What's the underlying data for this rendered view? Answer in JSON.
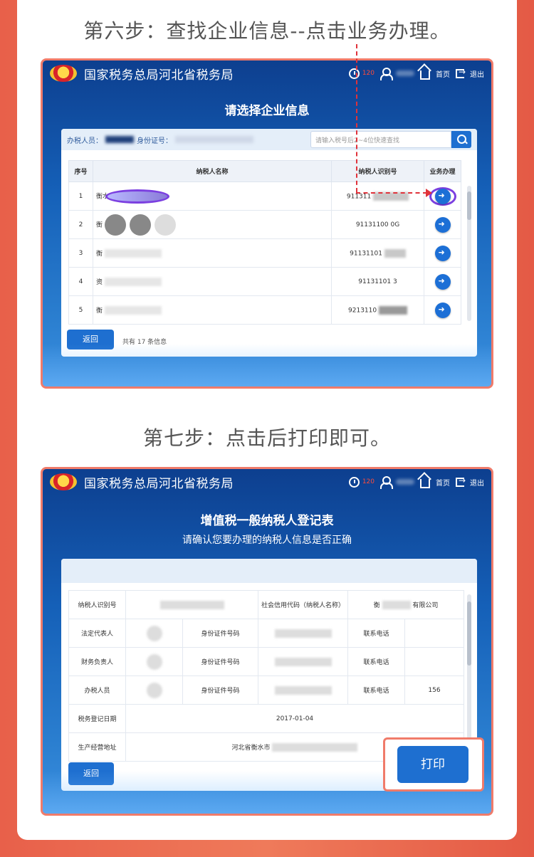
{
  "step6": {
    "title": "第六步：查找企业信息--点击业务办理。",
    "app_title": "国家税务总局河北省税务局",
    "timer": "120",
    "home_label": "首页",
    "logout_label": "退出",
    "panel_title": "请选择企业信息",
    "taxpayer_label": "办税人员：",
    "id_label": "身份证号：",
    "search_placeholder": "请输入税号后2~4位快速查找",
    "columns": [
      "序号",
      "纳税人名称",
      "纳税人识别号",
      "业务办理"
    ],
    "rows": [
      {
        "no": "1",
        "name": "衡水",
        "tax_id": "911311"
      },
      {
        "no": "2",
        "name": "衡",
        "tax_id": "91131100 0G"
      },
      {
        "no": "3",
        "name": "衡",
        "tax_id": "91131101"
      },
      {
        "no": "4",
        "name": "资",
        "tax_id": "91131101 3"
      },
      {
        "no": "5",
        "name": "衡",
        "tax_id": "9213110"
      }
    ],
    "back_label": "返回",
    "total_text": "共有 17 条信息"
  },
  "step7": {
    "title": "第七步：点击后打印即可。",
    "app_title": "国家税务总局河北省税务局",
    "timer": "120",
    "home_label": "首页",
    "logout_label": "退出",
    "panel_title": "增值税一般纳税人登记表",
    "panel_sub": "请确认您要办理的纳税人信息是否正确",
    "fields": {
      "taxpayer_id": "纳税人识别号",
      "credit_code": "社会信用代码（纳税人名称）",
      "company": "衡",
      "company_suffix": "有限公司",
      "legal_rep": "法定代表人",
      "id_type": "身份证件号码",
      "phone": "联系电话",
      "finance": "财务负责人",
      "agent": "办税人员",
      "phone_value": "156",
      "reg_date_label": "税务登记日期",
      "reg_date": "2017-01-04",
      "address_label": "生产经营地址",
      "address_value": "河北省衡水市"
    },
    "back_label": "返回",
    "print_label": "打印"
  },
  "colors": {
    "accent": "#1e6fd0",
    "frame": "#f07b6a",
    "highlight": "#7b3fe0",
    "arrow": "#e0323a"
  }
}
